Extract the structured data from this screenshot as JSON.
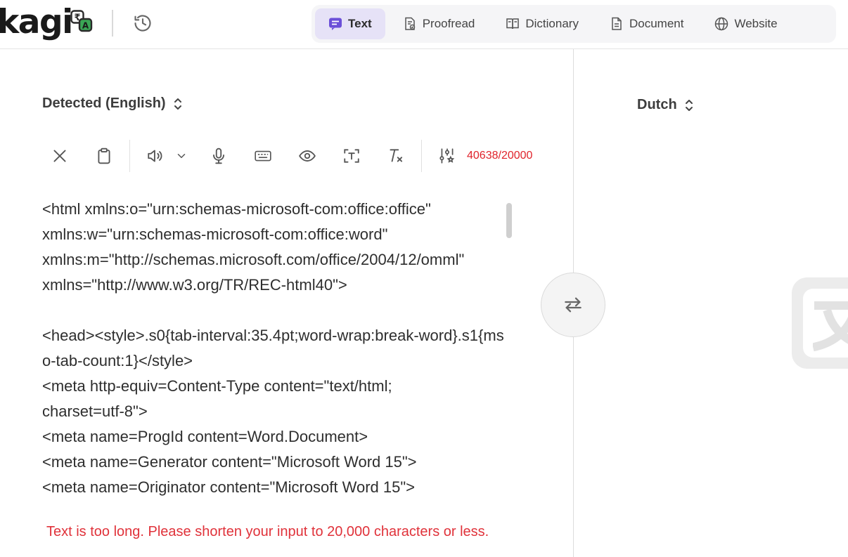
{
  "header": {
    "logo_text": "kagi",
    "logo_badge_glyphs": [
      "₹",
      "A"
    ],
    "tabs": [
      {
        "label": "Text",
        "icon": "chat-text-icon",
        "active": true
      },
      {
        "label": "Proofread",
        "icon": "proofread-icon",
        "active": false
      },
      {
        "label": "Dictionary",
        "icon": "book-icon",
        "active": false
      },
      {
        "label": "Document",
        "icon": "document-icon",
        "active": false
      },
      {
        "label": "Website",
        "icon": "globe-icon",
        "active": false
      }
    ]
  },
  "source": {
    "language": "Detected (English)",
    "counter": "40638/20000",
    "text": "<html xmlns:o=\"urn:schemas-microsoft-com:office:office\"\nxmlns:w=\"urn:schemas-microsoft-com:office:word\"\nxmlns:m=\"http://schemas.microsoft.com/office/2004/12/omml\"\nxmlns=\"http://www.w3.org/TR/REC-html40\">\n\n<head><style>.s0{tab-interval:35.4pt;word-wrap:break-word}.s1{mso-tab-count:1}</style>\n<meta http-equiv=Content-Type content=\"text/html;\ncharset=utf-8\">\n<meta name=ProgId content=Word.Document>\n<meta name=Generator content=\"Microsoft Word 15\">\n<meta name=Originator content=\"Microsoft Word 15\">",
    "error": "Text is too long. Please shorten your input to 20,000 characters or less."
  },
  "target": {
    "language": "Dutch"
  },
  "colors": {
    "accent": "#e6e2f7",
    "accent_icon": "#6b4fd8",
    "error": "#e0323a",
    "badge_green": "#3aa655"
  }
}
